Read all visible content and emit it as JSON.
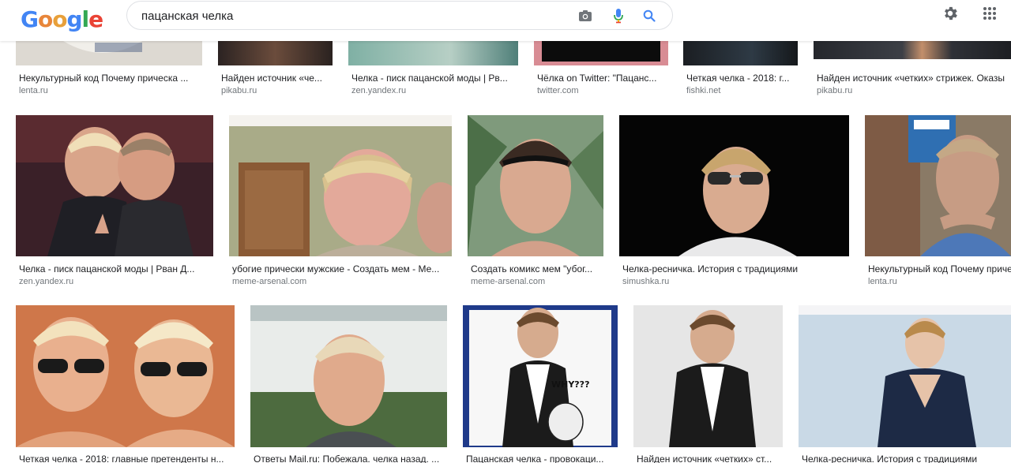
{
  "colors": {
    "blue": "#4285f4",
    "red": "#ea4335",
    "yellow": "#fbbc05",
    "green": "#34a853",
    "text": "#202124",
    "muted": "#70757a"
  },
  "logo": {
    "letters": [
      "G",
      "o",
      "o",
      "g",
      "l",
      "e"
    ]
  },
  "search": {
    "value": "пацанская челка"
  },
  "icons": {
    "camera": "camera-icon",
    "mic": "microphone-icon",
    "search": "search-icon",
    "settings": "gear-icon",
    "apps": "apps-grid-icon"
  },
  "row1": [
    {
      "title": "Некультурный код Почему прическа ...",
      "source": "lenta.ru"
    },
    {
      "title": "Найден источник «че...",
      "source": "pikabu.ru"
    },
    {
      "title": "Челка - писк пацанской моды | Рв...",
      "source": "zen.yandex.ru"
    },
    {
      "title": "Чёлка on Twitter: \"Пацанс...",
      "source": "twitter.com"
    },
    {
      "title": "Четкая челка - 2018: г...",
      "source": "fishki.net"
    },
    {
      "title": "Найден источник «четких» стрижек. Оказы",
      "source": "pikabu.ru"
    }
  ],
  "row2": [
    {
      "title": "Челка - писк пацанской моды | Рван Д...",
      "source": "zen.yandex.ru"
    },
    {
      "title": "убогие прически мужские - Создать мем - Ме...",
      "source": "meme-arsenal.com"
    },
    {
      "title": "Создать комикс мем \"убог...",
      "source": "meme-arsenal.com"
    },
    {
      "title": "Челка-ресничка. История с традициями",
      "source": "simushka.ru"
    },
    {
      "title": "Некультурный код Почему приче",
      "source": "lenta.ru"
    }
  ],
  "row3": [
    {
      "title": "Четкая челка - 2018: главные претенденты н..."
    },
    {
      "title": "Ответы Mail.ru: Побежала. челка назад. ..."
    },
    {
      "title": "Пацанская челка - провокаци..."
    },
    {
      "title": "Найден источник «четких» ст..."
    },
    {
      "title": "Челка-ресничка. История с традициями"
    }
  ],
  "meme_text": "WHY???"
}
